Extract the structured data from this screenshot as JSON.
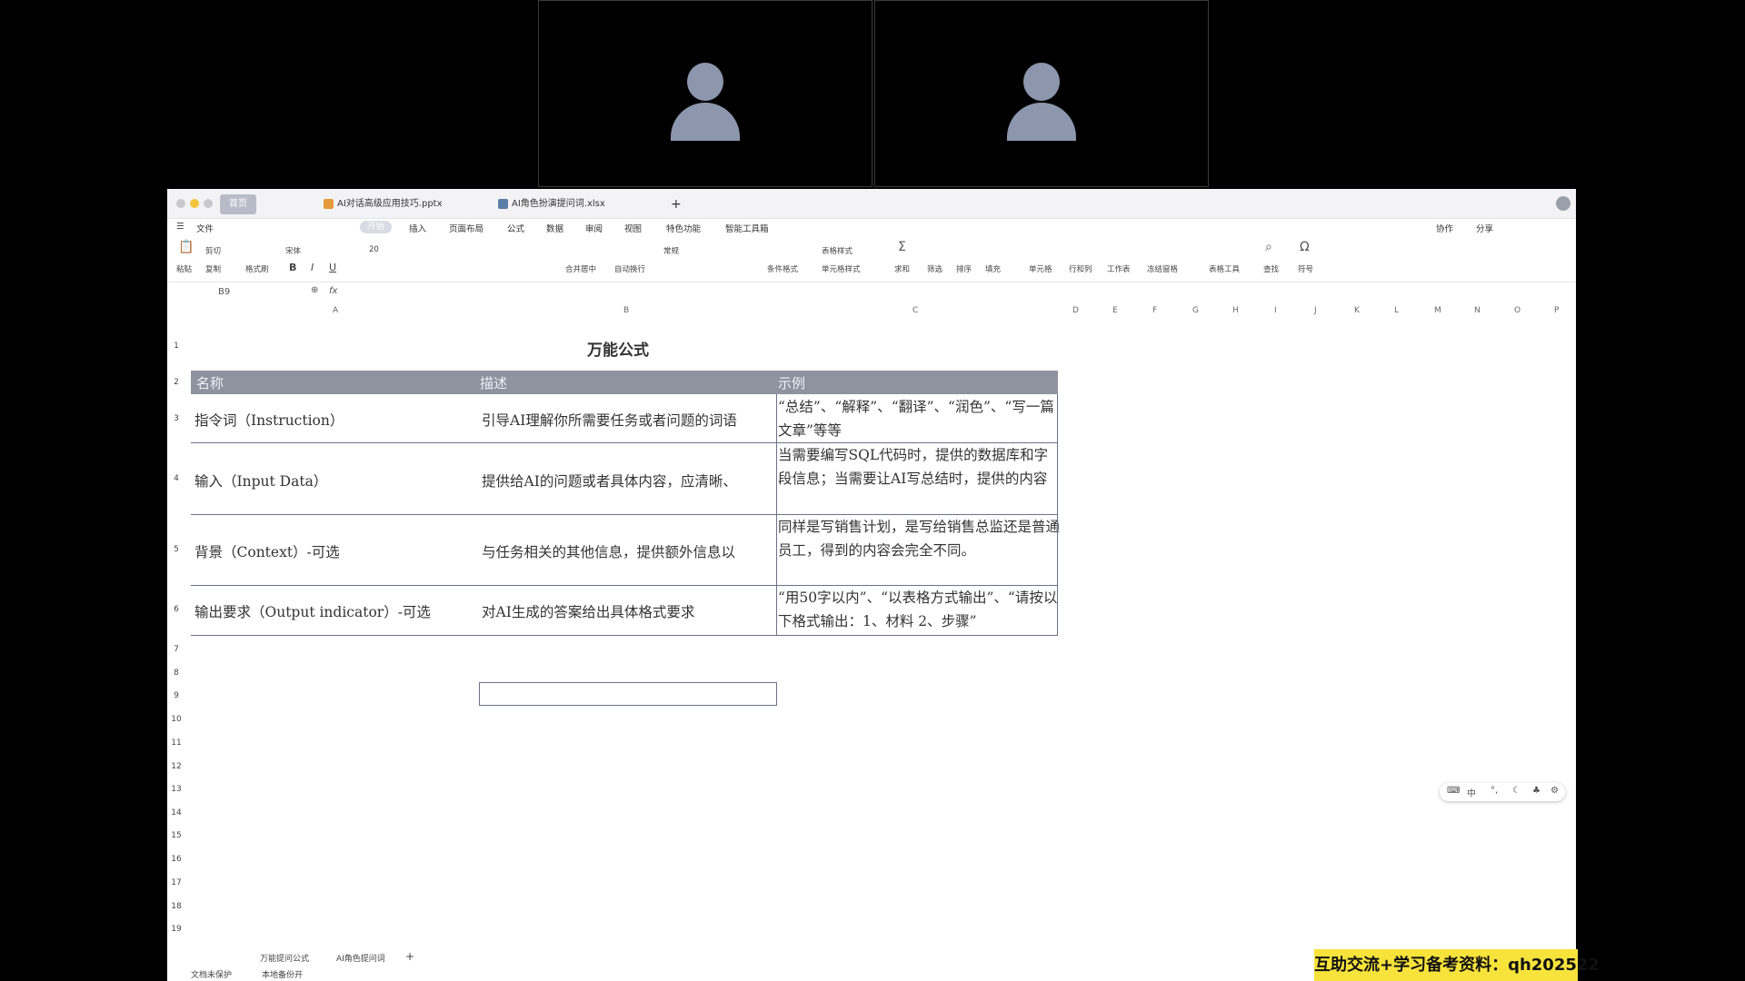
{
  "window_tabs": [
    "AI对话高级应用技巧.pptx",
    "AI角色扮演提问词.xlsx"
  ],
  "home_tab": "首页",
  "menu": [
    "文件",
    "开始",
    "插入",
    "页面布局",
    "公式",
    "数据",
    "审阅",
    "视图",
    "特色功能",
    "智能工具箱"
  ],
  "menu_right": [
    "协作",
    "分享"
  ],
  "ribbon": {
    "paste": "粘贴",
    "cut": "剪切",
    "copy": "复制",
    "format_painter": "格式刷",
    "font": "宋体",
    "font_size": "20",
    "merge": "合并居中",
    "wrap": "自动换行",
    "number_format": "常规",
    "cond_format": "条件格式",
    "table_style": "表格样式",
    "cell_style": "单元格样式",
    "sum": "求和",
    "filter": "筛选",
    "sort": "排序",
    "fill": "填充",
    "cells": "单元格",
    "rows_cols": "行和列",
    "worksheet": "工作表",
    "freeze": "冻结窗格",
    "table_tools": "表格工具",
    "find": "查找",
    "symbol": "符号"
  },
  "cell_ref": "B9",
  "fx": "fx",
  "columns": [
    "A",
    "B",
    "C",
    "D",
    "E",
    "F",
    "G",
    "H",
    "I",
    "J",
    "K",
    "L",
    "M",
    "N",
    "O",
    "P"
  ],
  "rows": [
    "1",
    "2",
    "3",
    "4",
    "5",
    "6",
    "7",
    "8",
    "9",
    "10",
    "11",
    "12",
    "13",
    "14",
    "15",
    "16",
    "17",
    "18",
    "19"
  ],
  "sheet": {
    "title": "万能公式",
    "headers": [
      "名称",
      "描述",
      "示例"
    ],
    "data": [
      {
        "name": "指令词（Instruction）",
        "desc": "引导AI理解你所需要任务或者问题的词语",
        "example": "“总结”、“解释”、“翻译”、“润色”、“写一篇文章”等等"
      },
      {
        "name": "输入（Input Data）",
        "desc": "提供给AI的问题或者具体内容，应清晰、",
        "example": "当需要编写SQL代码时，提供的数据库和字段信息；当需要让AI写总结时，提供的内容"
      },
      {
        "name": "背景（Context）-可选",
        "desc": "与任务相关的其他信息，提供额外信息以",
        "example": "同样是写销售计划，是写给销售总监还是普通员工，得到的内容会完全不同。"
      },
      {
        "name": "输出要求（Output indicator）-可选",
        "desc": "对AI生成的答案给出具体格式要求",
        "example": "“用50字以内”、“以表格方式输出”、“请按以下格式输出：1、材料 2、步骤”"
      }
    ]
  },
  "sheet_tabs": [
    "万能提问公式",
    "AI角色提问词"
  ],
  "status": [
    "文档未保护",
    "本地备份开"
  ],
  "floating_toolbar": [
    "中"
  ],
  "promo": "互助交流+学习备考资料：qh202522"
}
